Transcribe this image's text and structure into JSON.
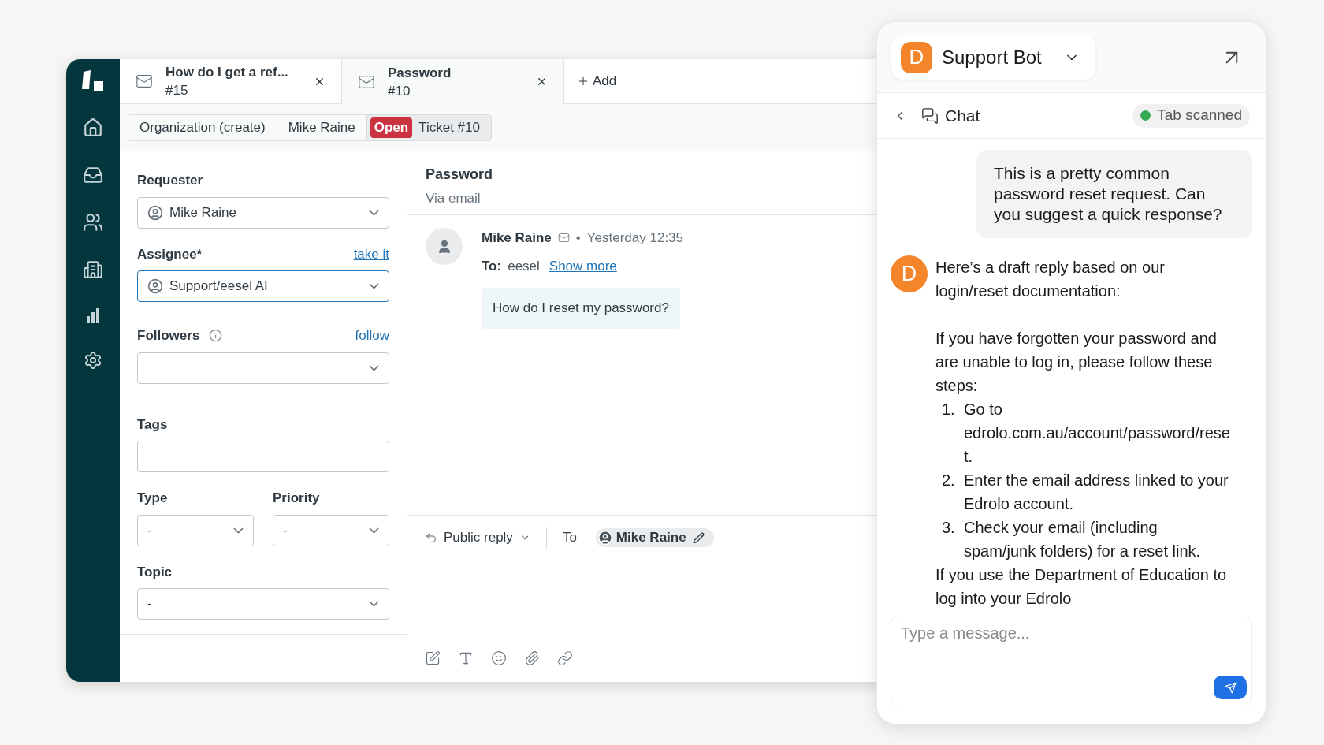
{
  "tabs": [
    {
      "title": "How do I get a ref...",
      "number": "#15",
      "selected": false
    },
    {
      "title": "Password",
      "number": "#10",
      "selected": true
    }
  ],
  "add_tab": {
    "label": "Add"
  },
  "breadcrumbs": [
    {
      "label": "Organization (create)"
    },
    {
      "label": "Mike Raine"
    },
    {
      "status": "Open",
      "label": "Ticket #10"
    }
  ],
  "ticket_fields": {
    "requester": {
      "label": "Requester",
      "value": "Mike Raine"
    },
    "assignee": {
      "label": "Assignee*",
      "link": "take it",
      "value": "Support/eesel AI"
    },
    "followers": {
      "label": "Followers",
      "link": "follow"
    },
    "tags": {
      "label": "Tags"
    },
    "type": {
      "label": "Type",
      "value": "-"
    },
    "priority": {
      "label": "Priority",
      "value": "-"
    },
    "topic": {
      "label": "Topic",
      "value": "-"
    }
  },
  "conversation": {
    "subject": "Password",
    "channel": "Via email",
    "messages": [
      {
        "author": "Mike Raine",
        "separator": "•",
        "time": "Yesterday 12:35",
        "to_label": "To:",
        "to": "eesel",
        "show_more": "Show more",
        "body": "How do I reset my password?"
      }
    ]
  },
  "composer": {
    "mode": "Public reply",
    "to_label": "To",
    "recipient": "Mike Raine"
  },
  "assistant": {
    "bot": {
      "initial": "D",
      "name": "Support Bot"
    },
    "section": "Chat",
    "status": {
      "label": "Tab scanned",
      "scanned": true
    },
    "messages": [
      {
        "kind": "user",
        "text": "This is a pretty common password reset request. Can you suggest a quick response?"
      },
      {
        "kind": "bot",
        "initial": "D",
        "blocks": [
          {
            "kind": "paragraph",
            "text": "Here’s a draft reply based on our login/reset documentation:"
          },
          {
            "kind": "paragraph",
            "text": "If you have forgotten your password and are unable to log in, please follow these steps:"
          },
          {
            "kind": "step",
            "number": "1.",
            "text": "Go to edrolo.com.au/account/password/reset."
          },
          {
            "kind": "step",
            "number": "2.",
            "text": "Enter the email address linked to your Edrolo account."
          },
          {
            "kind": "step",
            "number": "3.",
            "text": "Check your email (including spam/junk folders) for a reset link."
          },
          {
            "kind": "note",
            "text": "If you use the Department of Education to log into your Edrolo"
          }
        ]
      }
    ],
    "input": {
      "placeholder": "Type a message..."
    }
  }
}
